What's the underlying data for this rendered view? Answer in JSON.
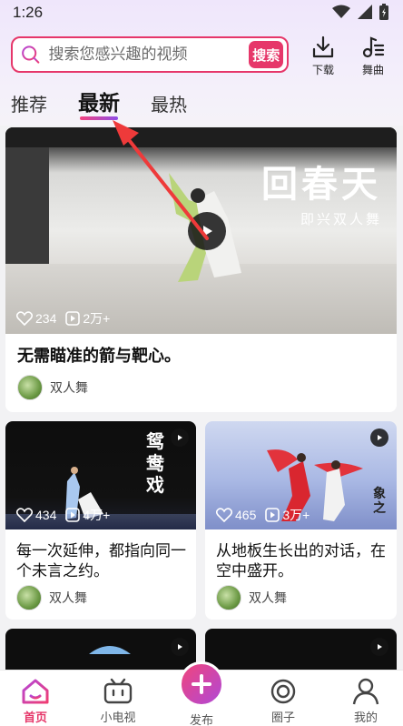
{
  "status_bar": {
    "time": "1:26"
  },
  "search": {
    "placeholder": "搜索您感兴趣的视频",
    "button_label": "搜索"
  },
  "top_actions": {
    "download_label": "下载",
    "dance_music_label": "舞曲"
  },
  "tabs": [
    {
      "label": "推荐",
      "active": false
    },
    {
      "label": "最新",
      "active": true
    },
    {
      "label": "最热",
      "active": false
    }
  ],
  "feed": {
    "featured": {
      "overlay_title": "回春天",
      "overlay_subtitle": "即兴双人舞",
      "likes": "234",
      "plays": "2万+",
      "title": "无需瞄准的箭与靶心。",
      "author": "双人舞"
    },
    "cards": [
      {
        "overlay_text": "鸳鸯戏",
        "likes": "434",
        "plays": "4万+",
        "title": "每一次延伸，都指向同一个未言之约。",
        "author": "双人舞"
      },
      {
        "overlay_text": "象之",
        "likes": "465",
        "plays": "3万+",
        "title": "从地板生长出的对话，在空中盛开。",
        "author": "双人舞"
      }
    ]
  },
  "bottom_nav": {
    "items": [
      {
        "label": "首页",
        "icon": "home-icon",
        "active": true
      },
      {
        "label": "小电视",
        "icon": "tv-icon",
        "active": false
      },
      {
        "label": "发布",
        "icon": "plus-icon",
        "active": false
      },
      {
        "label": "圈子",
        "icon": "circle-icon",
        "active": false
      },
      {
        "label": "我的",
        "icon": "person-icon",
        "active": false
      }
    ]
  },
  "colors": {
    "accent": "#e6376a",
    "tab_underline_start": "#f3417e",
    "tab_underline_end": "#8e4ee8"
  }
}
